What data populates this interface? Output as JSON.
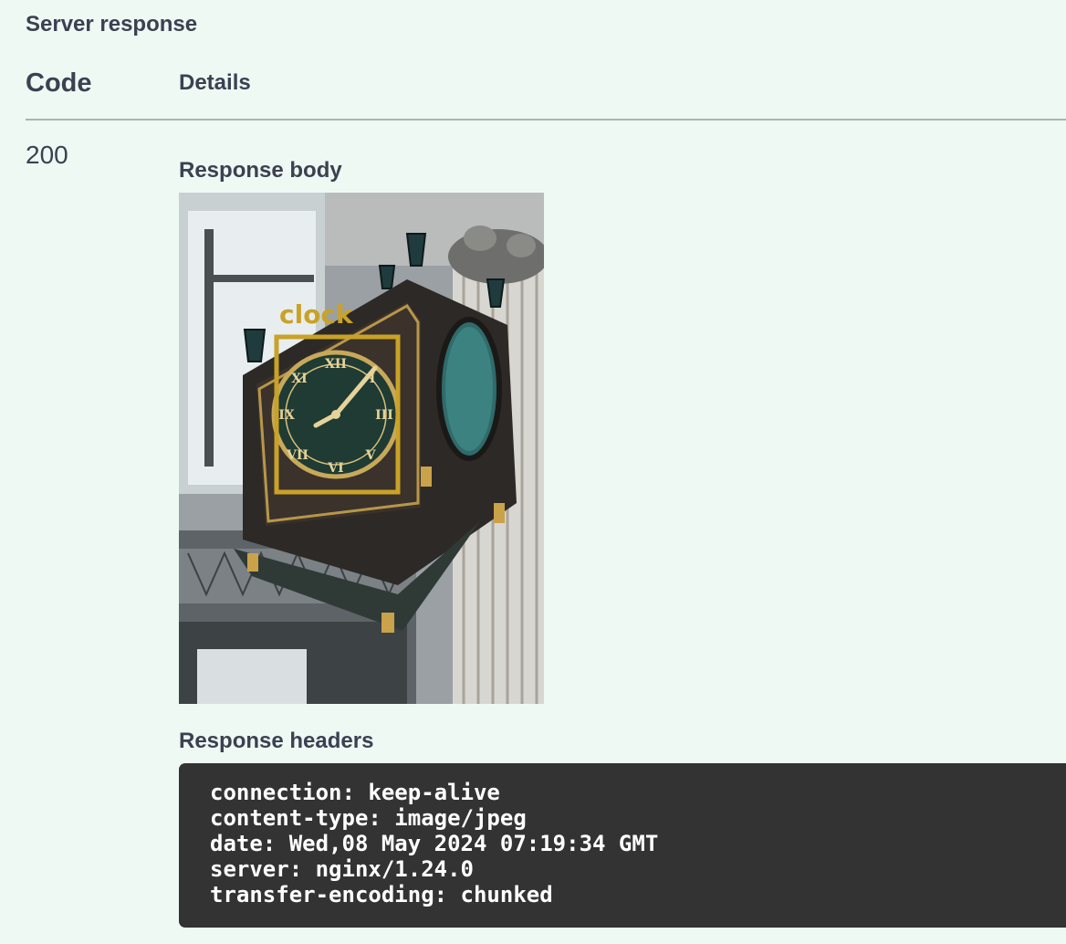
{
  "section": {
    "title": "Server response"
  },
  "table": {
    "code_header": "Code",
    "details_header": "Details"
  },
  "response": {
    "status_code": "200",
    "body_label": "Response body",
    "image": {
      "detection_label": "clock",
      "detection_color": "#c9a227"
    },
    "headers_label": "Response headers",
    "headers": [
      "connection: keep-alive",
      "content-type: image/jpeg",
      "date: Wed,08 May 2024 07:19:34 GMT",
      "server: nginx/1.24.0",
      "transfer-encoding: chunked"
    ]
  },
  "colors": {
    "background": "#eef9f3",
    "text": "#3b4151",
    "headers_bg": "#333333",
    "headers_text": "#ffffff"
  }
}
